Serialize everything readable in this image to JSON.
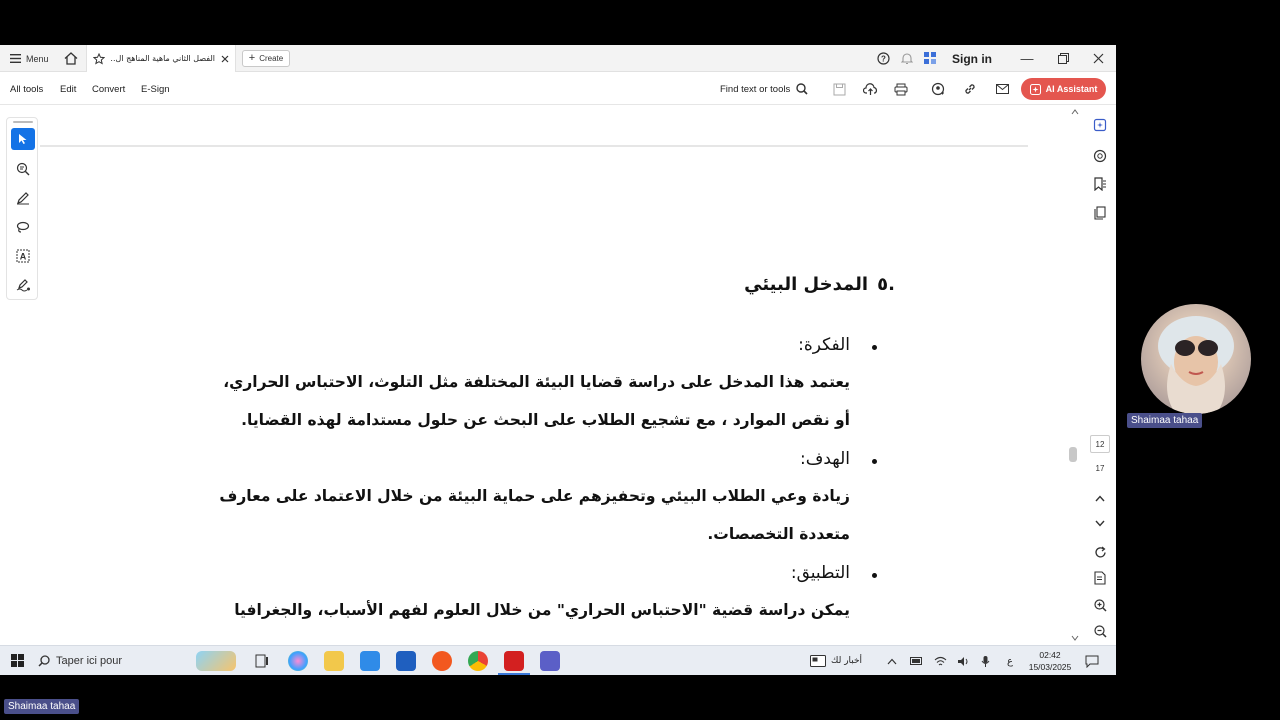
{
  "titlebar": {
    "menu_label": "Menu",
    "tab_title": "الفصل الثاني ماهية المناهج ال...",
    "create_label": "Create",
    "signin_label": "Sign in"
  },
  "toolbar": {
    "all_tools": "All tools",
    "edit": "Edit",
    "convert": "Convert",
    "esign": "E-Sign",
    "find": "Find text or tools",
    "ai_assistant": "AI Assistant"
  },
  "document": {
    "section_number": ".٥",
    "section_title": "المدخل البيئي",
    "idea_label": "الفكرة:",
    "idea_line1": "يعتمد هذا المدخل على دراسة قضايا البيئة المختلفة مثل التلوث، الاحتباس الحراري،",
    "idea_line2": "أو نقص الموارد ، مع تشجيع الطلاب على البحث عن حلول مستدامة لهذه القضايا.",
    "goal_label": "الهدف:",
    "goal_line1": "زيادة وعي الطلاب البيئي وتحفيزهم على حماية البيئة من خلال الاعتماد على معارف",
    "goal_line2": "متعددة التخصصات.",
    "apply_label": "التطبيق:",
    "apply_line1": "يمكن دراسة قضية \"الاحتباس الحراري\" من خلال العلوم لفهم الأسباب، والجغرافيا"
  },
  "page_nav": {
    "current": "12",
    "total": "17"
  },
  "taskbar": {
    "search_placeholder": "Taper ici pour",
    "news": "أخبار لك",
    "lang": "ع",
    "time": "02:42",
    "date": "15/03/2025"
  },
  "video": {
    "participant_name": "Shaimaa tahaa",
    "self_name": "Shaimaa tahaa"
  },
  "colors": {
    "accent": "#1473e6",
    "ai_button": "#e4564f",
    "name_tag": "#4a4f8a"
  }
}
